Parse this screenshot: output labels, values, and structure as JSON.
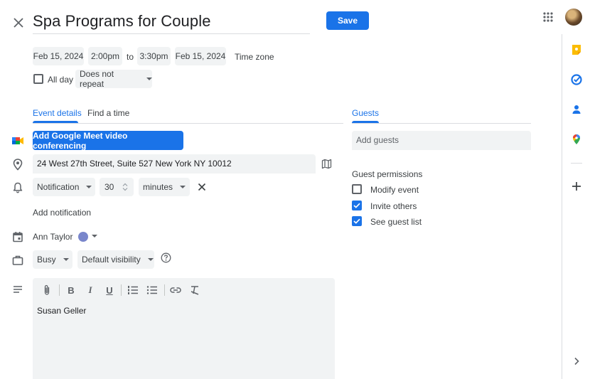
{
  "event": {
    "title": "Spa Programs for Couple",
    "save_label": "Save",
    "start_date": "Feb 15, 2024",
    "start_time": "2:00pm",
    "to_label": "to",
    "end_time": "3:30pm",
    "end_date": "Feb 15, 2024",
    "timezone_label": "Time zone",
    "all_day_label": "All day",
    "all_day_checked": false,
    "repeat": "Does not repeat"
  },
  "tabs": {
    "event_details": "Event details",
    "find_a_time": "Find a time",
    "guests": "Guests"
  },
  "details": {
    "meet_button": "Add Google Meet video conferencing",
    "location": "24 West 27th Street, Suite 527 New York NY 10012",
    "notification_type": "Notification",
    "notification_value": "30",
    "notification_unit": "minutes",
    "add_notification": "Add notification",
    "owner": "Ann Taylor",
    "event_color": "#7986cb",
    "availability": "Busy",
    "visibility": "Default visibility",
    "description": "Susan Geller"
  },
  "guests": {
    "placeholder": "Add guests",
    "permissions_title": "Guest permissions",
    "permissions": [
      {
        "label": "Modify event",
        "checked": false
      },
      {
        "label": "Invite others",
        "checked": true
      },
      {
        "label": "See guest list",
        "checked": true
      }
    ]
  },
  "colors": {
    "accent": "#1a73e8",
    "chip_bg": "#f1f3f4"
  },
  "icons": {
    "side_panel": [
      "keep-icon",
      "tasks-icon",
      "contacts-icon",
      "maps-icon",
      "add-icon",
      "chevron-right-icon"
    ]
  }
}
